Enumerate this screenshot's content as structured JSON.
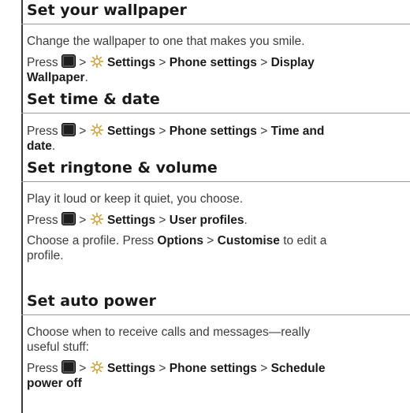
{
  "sections": [
    {
      "heading": "Set your wallpaper",
      "intro": "Change the wallpaper to one that makes you smile.",
      "press": "Press",
      "sep": ">",
      "path": [
        "Settings",
        "Phone settings",
        "Display"
      ],
      "path_tail": "Wallpaper",
      "end": "."
    },
    {
      "heading": "Set time & date",
      "press": "Press",
      "sep": ">",
      "path": [
        "Settings",
        "Phone settings",
        "Time and"
      ],
      "path_tail": "date",
      "end": "."
    },
    {
      "heading": "Set ringtone & volume",
      "intro": "Play it loud or keep it quiet, you choose.",
      "press": "Press",
      "sep": ">",
      "path": [
        "Settings",
        "User profiles"
      ],
      "end": ".",
      "extra_pre": "Choose a profile. Press",
      "extra_opt1": "Options",
      "extra_opt2": "Customise",
      "extra_post": "to edit a",
      "extra_line2": "profile."
    },
    {
      "heading": "Set auto power",
      "intro_line1": "Choose when to receive calls and messages—really",
      "intro_line2": "useful stuff:",
      "press": "Press",
      "sep": ">",
      "path": [
        "Settings",
        "Phone settings",
        "Schedule"
      ],
      "path_tail": "power off"
    }
  ],
  "icons": {
    "menu_key": "menu-key-icon",
    "settings": "gear-icon"
  }
}
